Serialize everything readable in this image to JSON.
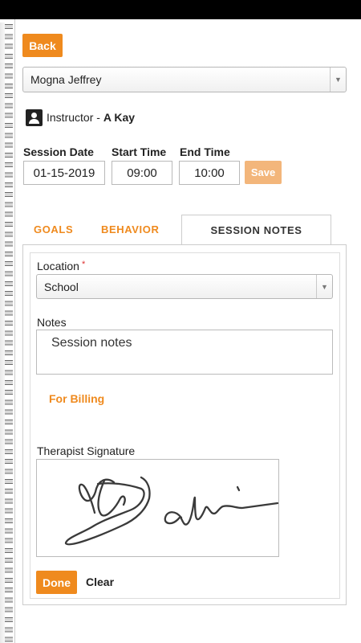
{
  "header": {
    "back_label": "Back"
  },
  "student_select": {
    "value": "Mogna Jeffrey"
  },
  "instructor": {
    "label": "Instructor -",
    "name": "A Kay",
    "icon": "person-icon"
  },
  "session": {
    "date_label": "Session Date",
    "start_label": "Start Time",
    "end_label": "End Time",
    "date_value": "01-15-2019",
    "start_value": "09:00",
    "end_value": "10:00",
    "save_label": "Save"
  },
  "tabs": [
    {
      "label": "GOALS",
      "active": false
    },
    {
      "label": "BEHAVIOR",
      "active": false
    },
    {
      "label": "SESSION NOTES",
      "active": true
    }
  ],
  "form": {
    "location_label": "Location",
    "required_mark": "*",
    "location_value": "School",
    "notes_label": "Notes",
    "notes_value": "Session notes",
    "billing_link": "For Billing",
    "signature_label": "Therapist Signature",
    "done_label": "Done",
    "clear_label": "Clear"
  },
  "colors": {
    "accent": "#ef8a1e",
    "accent_disabled": "#f3b67b",
    "required": "#dd3333"
  }
}
